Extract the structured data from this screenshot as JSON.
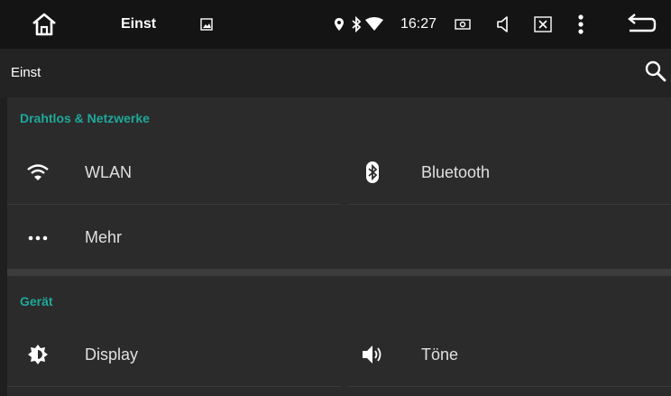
{
  "status_bar": {
    "app_name": "Einst",
    "time": "16:27",
    "icons": [
      "home-icon",
      "image-icon",
      "location-icon",
      "bluetooth-icon",
      "wifi-icon",
      "screenshot-icon",
      "volume-icon",
      "close-box-icon",
      "menu-icon",
      "back-icon"
    ]
  },
  "app_bar": {
    "title": "Einst",
    "search_icon": "search-icon"
  },
  "sections": [
    {
      "title": "Drahtlos & Netzwerke",
      "items": [
        {
          "label": "WLAN",
          "icon": "wifi-icon"
        },
        {
          "label": "Bluetooth",
          "icon": "bluetooth-icon"
        },
        {
          "label": "Mehr",
          "icon": "more-icon"
        }
      ]
    },
    {
      "title": "Gerät",
      "items": [
        {
          "label": "Display",
          "icon": "brightness-icon"
        },
        {
          "label": "Töne",
          "icon": "sound-icon"
        }
      ]
    }
  ],
  "colors": {
    "accent": "#1fa89a",
    "background": "#1f1f1f",
    "panel": "#2b2b2b",
    "status_bar": "#141414"
  }
}
